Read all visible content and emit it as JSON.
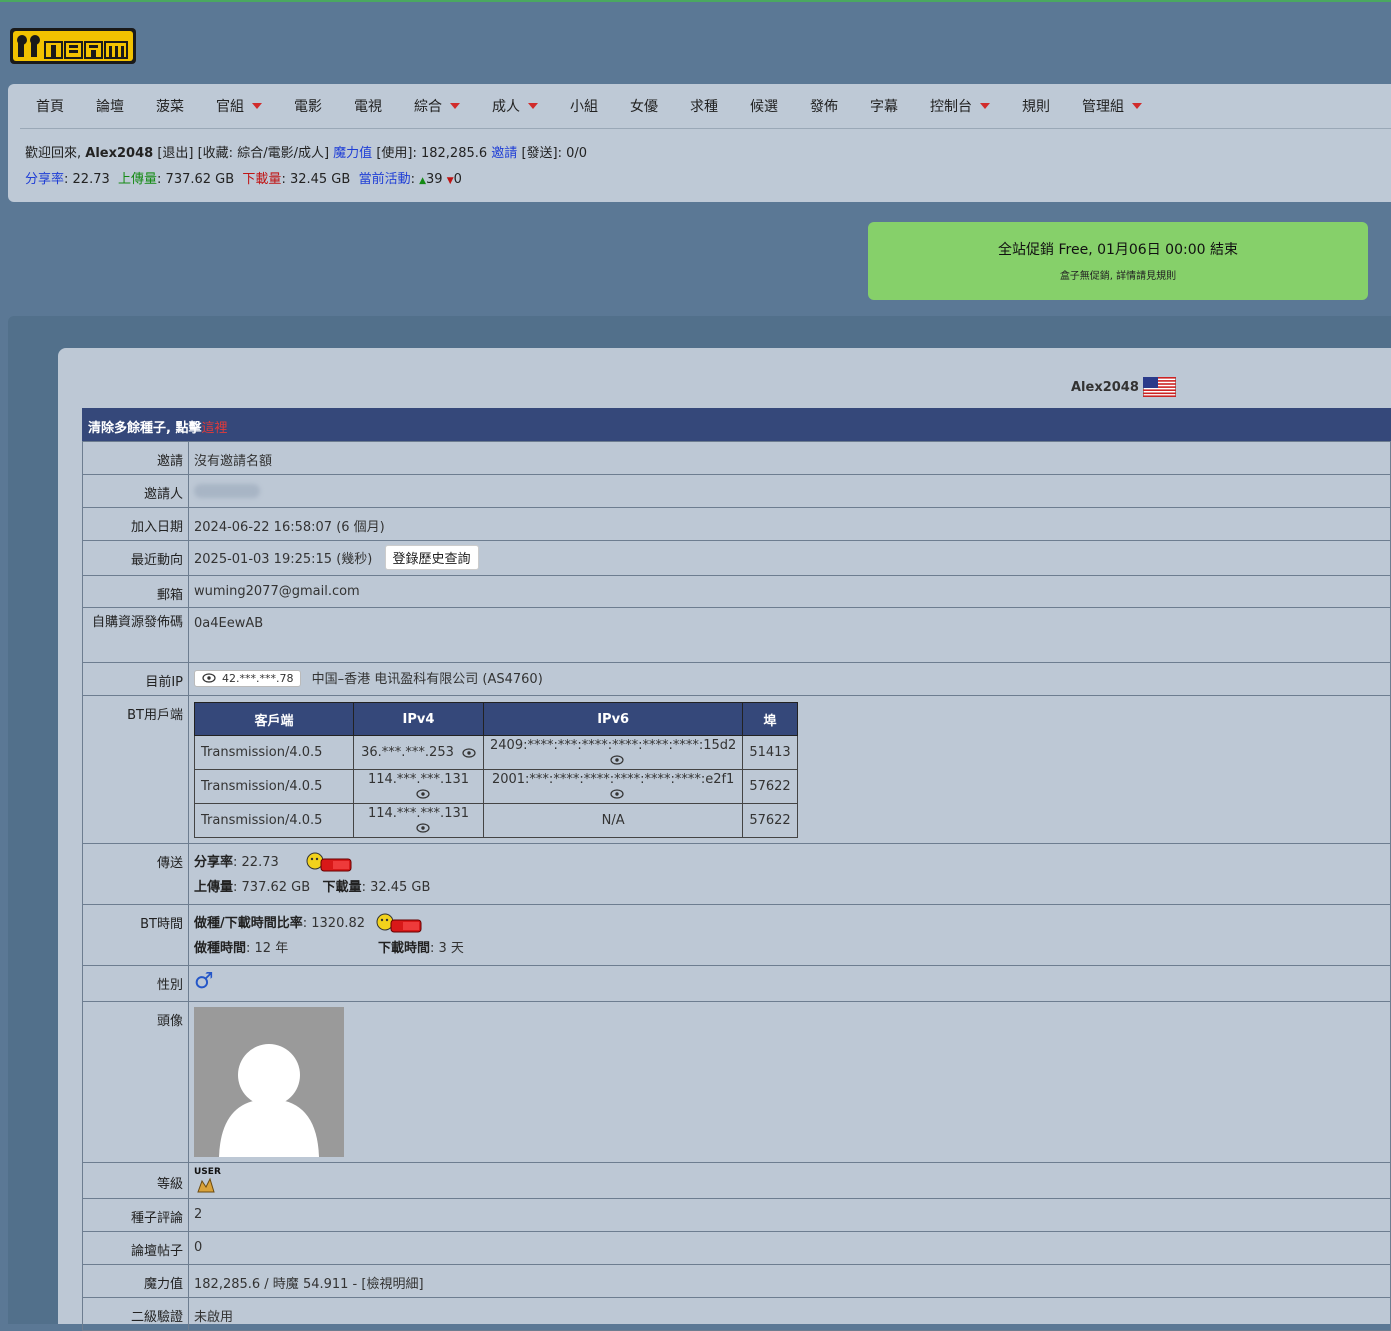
{
  "site": {
    "logo_alt": "M-TEAM"
  },
  "nav": {
    "items": [
      {
        "label": "首頁",
        "dropdown": false
      },
      {
        "label": "論壇",
        "dropdown": false
      },
      {
        "label": "菠菜",
        "dropdown": false
      },
      {
        "label": "官組",
        "dropdown": true
      },
      {
        "label": "電影",
        "dropdown": false
      },
      {
        "label": "電視",
        "dropdown": false
      },
      {
        "label": "綜合",
        "dropdown": true
      },
      {
        "label": "成人",
        "dropdown": true
      },
      {
        "label": "小組",
        "dropdown": false
      },
      {
        "label": "女優",
        "dropdown": false
      },
      {
        "label": "求種",
        "dropdown": false
      },
      {
        "label": "候選",
        "dropdown": false
      },
      {
        "label": "發佈",
        "dropdown": false
      },
      {
        "label": "字幕",
        "dropdown": false
      },
      {
        "label": "控制台",
        "dropdown": true
      },
      {
        "label": "規則",
        "dropdown": false
      },
      {
        "label": "管理組",
        "dropdown": true
      }
    ]
  },
  "userbar": {
    "welcome": "歡迎回來, ",
    "username": "Alex2048",
    "logout": "[退出]",
    "favorites": "[收藏: 綜合/電影/成人]",
    "magic_label": "魔力值",
    "magic_use": "[使用]: 182,285.6",
    "invite_label": "邀請",
    "invite_send": "[發送]: 0/0",
    "ratio_label": "分享率",
    "ratio_value": ": 22.73",
    "upload_label": "上傳量",
    "upload_value": ": 737.62 GB",
    "download_label": "下載量",
    "download_value": ": 32.45 GB",
    "activity_label": "當前活動",
    "seeding": "39",
    "leeching": "0"
  },
  "promo": {
    "line1": "全站促銷 Free, 01月06日 00:00 結束",
    "line2": "盒子無促銷, 詳情請見規則"
  },
  "profile": {
    "username": "Alex2048",
    "banner_text": "清除多餘種子, 點擊",
    "banner_link": "這裡",
    "rows": {
      "invite": {
        "label": "邀請",
        "value": "沒有邀請名額"
      },
      "inviter": {
        "label": "邀請人"
      },
      "joined": {
        "label": "加入日期",
        "value": "2024-06-22 16:58:07 (6 個月)"
      },
      "last_action": {
        "label": "最近動向",
        "value": "2025-01-03 19:25:15 (幾秒)",
        "button": "登錄歷史查詢"
      },
      "email": {
        "label": "郵箱",
        "value": "wuming2077@gmail.com"
      },
      "self_code": {
        "label": "自購資源發佈碼",
        "value": "0a4EewAB"
      },
      "current_ip": {
        "label": "目前IP",
        "ip": "42.***.***.78",
        "location": "中国–香港 电讯盈科有限公司 (AS4760)"
      },
      "bt_client": {
        "label": "BT用戶端"
      },
      "transfer": {
        "label": "傳送",
        "ratio_label": "分享率",
        "ratio_value": ": 22.73",
        "up_label": "上傳量",
        "up_value": ": 737.62 GB",
        "down_label": "下載量",
        "down_value": ": 32.45 GB"
      },
      "bt_time": {
        "label": "BT時間",
        "ratio_label": "做種/下載時間比率",
        "ratio_value": ": 1320.82",
        "seed_label": "做種時間",
        "seed_value": ": 12 年",
        "dl_label": "下載時間",
        "dl_value": ": 3 天"
      },
      "gender": {
        "label": "性別"
      },
      "avatar": {
        "label": "頭像"
      },
      "rank": {
        "label": "等級",
        "value": "USER"
      },
      "torrent_comments": {
        "label": "種子評論",
        "value": "2"
      },
      "forum_posts": {
        "label": "論壇帖子",
        "value": "0"
      },
      "magic": {
        "label": "魔力值",
        "value": "182,285.6 / 時魔 54.911 - [檢視明細]"
      },
      "twofa": {
        "label": "二級驗證",
        "value": "未啟用"
      }
    },
    "bt_table": {
      "headers": [
        "客戶端",
        "IPv4",
        "IPv6",
        "埠"
      ],
      "rows": [
        {
          "client": "Transmission/4.0.5",
          "ipv4": "36.***.***.253",
          "ipv6": "2409:****:***:****:****:****:****:15d2",
          "port": "51413"
        },
        {
          "client": "Transmission/4.0.5",
          "ipv4": "114.***.***.131",
          "ipv6": "2001:***:****:****:****:****:****:e2f1",
          "port": "57622"
        },
        {
          "client": "Transmission/4.0.5",
          "ipv4": "114.***.***.131",
          "ipv6": "N/A",
          "port": "57622"
        }
      ]
    }
  },
  "colors": {
    "banner": "#35487a",
    "promo": "#86d06a",
    "page_bg": "#5b7895",
    "card": "#bdc8d5"
  }
}
